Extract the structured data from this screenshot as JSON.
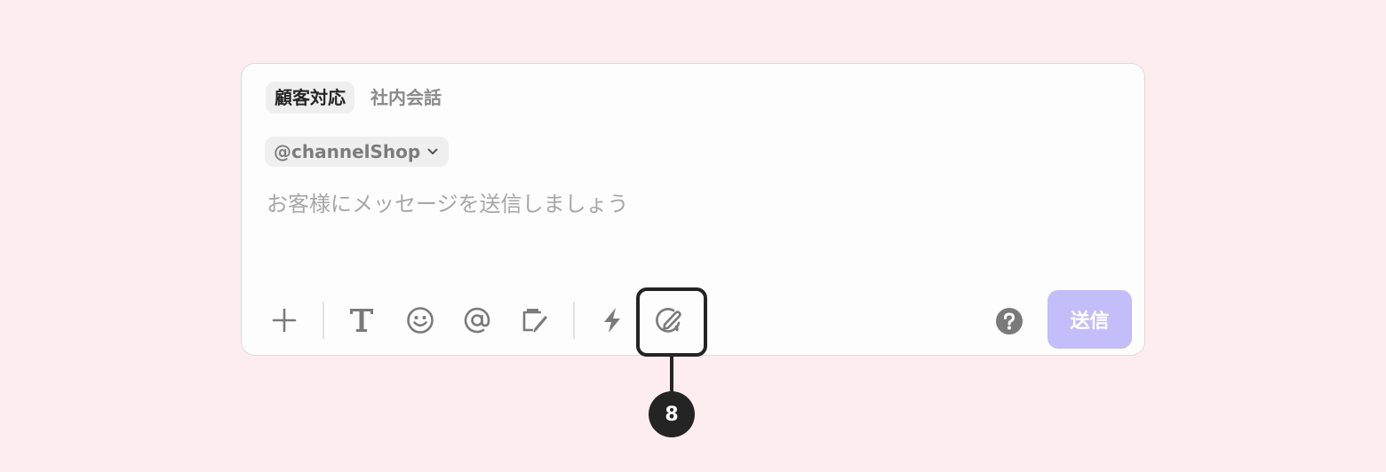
{
  "tabs": [
    {
      "label": "顧客対応",
      "active": true
    },
    {
      "label": "社内会話",
      "active": false
    }
  ],
  "channel": {
    "selected": "@channelShop",
    "icon": "chevron-down-icon"
  },
  "message": {
    "value": "",
    "placeholder": "お客様にメッセージを送信しましょう"
  },
  "toolbar": {
    "icons": [
      "plus-icon",
      "text-format-icon",
      "emoji-icon",
      "mention-icon",
      "template-icon",
      "lightning-icon",
      "signature-icon",
      "help-icon"
    ],
    "send_label": "送信"
  },
  "callout": {
    "number": "8"
  },
  "colors": {
    "background": "#feedf0",
    "send_button": "#c3bdfa",
    "highlight": "#242424",
    "icon": "#7a7a7a"
  }
}
